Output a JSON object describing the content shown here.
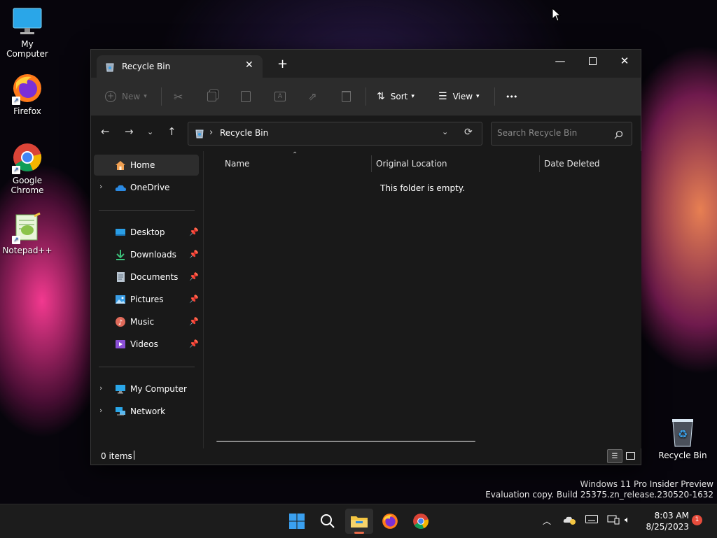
{
  "desktop": {
    "icons": [
      {
        "label": "My Computer"
      },
      {
        "label": "Firefox"
      },
      {
        "label": "Google Chrome"
      },
      {
        "label": "Notepad++"
      },
      {
        "label": "Recycle Bin"
      }
    ],
    "watermark_line1": "Windows 11 Pro Insider Preview",
    "watermark_line2": "Evaluation copy. Build 25375.zn_release.230520-1632"
  },
  "explorer": {
    "tab_title": "Recycle Bin",
    "new_tab_label": "+",
    "toolbar": {
      "new_label": "New",
      "sort_label": "Sort",
      "view_label": "View",
      "more_label": "•••"
    },
    "address": {
      "path": "Recycle Bin",
      "separator": "›"
    },
    "search": {
      "placeholder": "Search Recycle Bin"
    },
    "sidebar": {
      "home": "Home",
      "onedrive": "OneDrive",
      "quick_access": [
        {
          "label": "Desktop"
        },
        {
          "label": "Downloads"
        },
        {
          "label": "Documents"
        },
        {
          "label": "Pictures"
        },
        {
          "label": "Music"
        },
        {
          "label": "Videos"
        }
      ],
      "my_computer": "My Computer",
      "network": "Network"
    },
    "columns": [
      "Name",
      "Original Location",
      "Date Deleted"
    ],
    "empty_message": "This folder is empty.",
    "status": {
      "item_count": "0 items"
    }
  },
  "taskbar": {
    "time": "8:03 AM",
    "date": "8/25/2023",
    "notification_count": "1"
  },
  "colors": {
    "accent": "#0078d4",
    "folder_yellow": "#f4c542",
    "notification_badge": "#e74c3c"
  }
}
